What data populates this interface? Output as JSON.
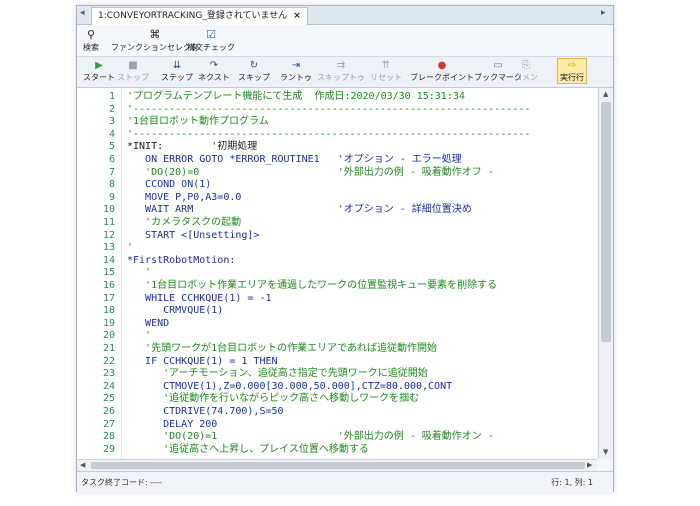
{
  "tab": {
    "title": "1:CONVEYORTRACKING_登録されていません",
    "close": "×",
    "left_arrow": "◂",
    "right_arrow": "▸"
  },
  "toolbar": [
    {
      "label": "検索",
      "icon": "search-icon",
      "glyph": "⚲"
    },
    {
      "label": "ファンクションセレクタ",
      "icon": "function-selector-icon",
      "glyph": "⌘"
    },
    {
      "label": "構文チェック",
      "icon": "syntax-check-icon",
      "glyph": "☑"
    }
  ],
  "run_toolbar": [
    {
      "label": "スタート",
      "icon": "start-icon",
      "glyph": "▶",
      "color": "#2ea043",
      "disabled": false
    },
    {
      "label": "ストップ",
      "icon": "stop-icon",
      "glyph": "■",
      "color": "#9aa3ae",
      "disabled": true
    },
    {
      "label": "ステップ",
      "icon": "step-icon",
      "glyph": "⇊",
      "color": "#2b4f8a",
      "disabled": false
    },
    {
      "label": "ネクスト",
      "icon": "next-icon",
      "glyph": "↷",
      "color": "#2b4f8a",
      "disabled": false
    },
    {
      "label": "スキップ",
      "icon": "skip-icon",
      "glyph": "↻",
      "color": "#2b4f8a",
      "disabled": false
    },
    {
      "label": "ラントゥ",
      "icon": "run-to-icon",
      "glyph": "⇥",
      "color": "#2b4f8a",
      "disabled": false
    },
    {
      "label": "スキップトゥ",
      "icon": "skip-to-icon",
      "glyph": "⇉",
      "color": "#9aa3ae",
      "disabled": true
    },
    {
      "label": "リセット",
      "icon": "reset-icon",
      "glyph": "⇈",
      "color": "#9aa3ae",
      "disabled": true
    },
    {
      "label": "ブレークポイント",
      "icon": "breakpoint-icon",
      "glyph": "●",
      "color": "#d23a2c",
      "disabled": false
    },
    {
      "label": "ブックマーク",
      "icon": "bookmark-icon",
      "glyph": "▭",
      "color": "#5a7bb5",
      "disabled": false
    },
    {
      "label": "コメン",
      "icon": "comment-icon",
      "glyph": "⎘",
      "color": "#9aa3ae",
      "disabled": true
    },
    {
      "label": "実行行",
      "icon": "current-line-icon",
      "glyph": "⇨",
      "color": "#e0a800",
      "disabled": false,
      "active": true
    }
  ],
  "code_lines": [
    {
      "n": "1",
      "text": "'プログラムテンプレート機能にて生成  作成日:2020/03/30 15:31:34",
      "kind": "comment"
    },
    {
      "n": "2",
      "text": "'------------------------------------------------------------------",
      "kind": "comment"
    },
    {
      "n": "3",
      "text": "'1台目ロボット動作プログラム",
      "kind": "comment"
    },
    {
      "n": "4",
      "text": "'------------------------------------------------------------------",
      "kind": "comment"
    },
    {
      "n": "5",
      "text": "*INIT:        '初期処理",
      "kind": "mixed"
    },
    {
      "n": "6",
      "text": "   ON ERROR GOTO *ERROR_ROUTINE1   'オプション - エラー処理",
      "kind": "code"
    },
    {
      "n": "7",
      "text": "   'DO(20)=0                       '外部出力の例 - 吸着動作オフ -",
      "kind": "comment"
    },
    {
      "n": "8",
      "text": "   CCOND ON(1)",
      "kind": "code"
    },
    {
      "n": "9",
      "text": "   MOVE P,P0,A3=0.0",
      "kind": "code"
    },
    {
      "n": "10",
      "text": "   WAIT ARM                        'オプション - 詳細位置決め",
      "kind": "code"
    },
    {
      "n": "11",
      "text": "   'カメラタスクの起動",
      "kind": "comment"
    },
    {
      "n": "12",
      "text": "   START <[Unsetting]>",
      "kind": "code"
    },
    {
      "n": "13",
      "text": "'",
      "kind": "comment"
    },
    {
      "n": "14",
      "text": "*FirstRobotMotion:",
      "kind": "code"
    },
    {
      "n": "15",
      "text": "   '",
      "kind": "comment"
    },
    {
      "n": "16",
      "text": "   '1台目ロボット作業エリアを通過したワークの位置監視キュー要素を削除する",
      "kind": "comment"
    },
    {
      "n": "17",
      "text": "   WHILE CCHKQUE(1) = -1",
      "kind": "code"
    },
    {
      "n": "18",
      "text": "      CRMVQUE(1)",
      "kind": "code"
    },
    {
      "n": "19",
      "text": "   WEND",
      "kind": "code"
    },
    {
      "n": "20",
      "text": "   '",
      "kind": "comment"
    },
    {
      "n": "21",
      "text": "   '先頭ワークが1台目ロボットの作業エリアであれば追従動作開始",
      "kind": "comment"
    },
    {
      "n": "22",
      "text": "   IF CCHKQUE(1) = 1 THEN",
      "kind": "code"
    },
    {
      "n": "23",
      "text": "      'アーチモーション、追従高さ指定で先頭ワークに追従開始",
      "kind": "comment"
    },
    {
      "n": "24",
      "text": "      CTMOVE(1),Z=0.000[30.000,50.000],CTZ=80.000,CONT",
      "kind": "code"
    },
    {
      "n": "25",
      "text": "      '追従動作を行いながらピック高さへ移動しワークを掴む",
      "kind": "comment"
    },
    {
      "n": "26",
      "text": "      CTDRIVE(74.700),S=50",
      "kind": "code"
    },
    {
      "n": "27",
      "text": "      DELAY 200",
      "kind": "code"
    },
    {
      "n": "28",
      "text": "      'DO(20)=1                    '外部出力の例 - 吸着動作オン -",
      "kind": "comment"
    },
    {
      "n": "29",
      "text": "      '追従高さへ上昇し、プレイス位置へ移動する",
      "kind": "comment"
    }
  ],
  "status": {
    "left": "タスク終了コード: ----",
    "right": "行: 1, 列: 1"
  }
}
